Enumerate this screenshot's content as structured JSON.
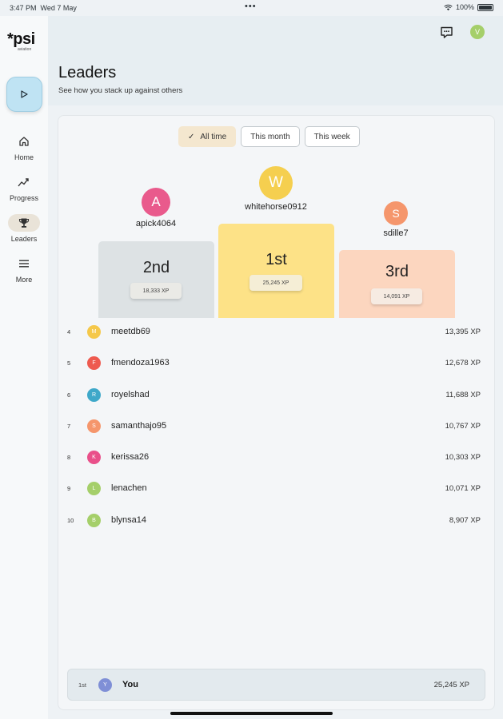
{
  "status_bar": {
    "time": "3:47 PM",
    "date": "Wed 7 May",
    "battery": "100%",
    "icons": [
      "wifi-icon",
      "battery-icon"
    ]
  },
  "app": {
    "logo_text": "*psi",
    "logo_sub": "aviation"
  },
  "sidebar": {
    "play_icon": "play-icon",
    "items": [
      {
        "label": "Home",
        "icon": "home-icon",
        "active": false
      },
      {
        "label": "Progress",
        "icon": "progress-chart-icon",
        "active": false
      },
      {
        "label": "Leaders",
        "icon": "trophy-icon",
        "active": true
      },
      {
        "label": "More",
        "icon": "menu-lines-icon",
        "active": false
      }
    ]
  },
  "header": {
    "title": "Leaders",
    "subtitle": "See how you stack up against others",
    "user_initial": "V",
    "chat_icon": "chat-icon"
  },
  "filters": [
    {
      "label": "All time",
      "selected": true
    },
    {
      "label": "This month",
      "selected": false
    },
    {
      "label": "This week",
      "selected": false
    }
  ],
  "podium": {
    "first": {
      "initial": "W",
      "name": "whitehorse0912",
      "place": "1st",
      "xp": "25,245 XP",
      "avatar_color": "#f5cf4f",
      "block_color": "#fde287"
    },
    "second": {
      "initial": "A",
      "name": "apick4064",
      "place": "2nd",
      "xp": "18,333 XP",
      "avatar_color": "#e95a8c",
      "block_color": "#dde2e4"
    },
    "third": {
      "initial": "S",
      "name": "sdille7",
      "place": "3rd",
      "xp": "14,091 XP",
      "avatar_color": "#f5966c",
      "block_color": "#fcd6bf"
    }
  },
  "leaderboard": [
    {
      "rank": "4",
      "initial": "M",
      "name": "meetdb69",
      "xp": "13,395 XP",
      "color": "#f5c84a"
    },
    {
      "rank": "5",
      "initial": "F",
      "name": "fmendoza1963",
      "xp": "12,678 XP",
      "color": "#ee5a4f"
    },
    {
      "rank": "6",
      "initial": "R",
      "name": "royelshad",
      "xp": "11,688 XP",
      "color": "#3ea8c9"
    },
    {
      "rank": "7",
      "initial": "S",
      "name": "samanthajo95",
      "xp": "10,767 XP",
      "color": "#f5966c"
    },
    {
      "rank": "8",
      "initial": "K",
      "name": "kerissa26",
      "xp": "10,303 XP",
      "color": "#e9508a"
    },
    {
      "rank": "9",
      "initial": "L",
      "name": "lenachen",
      "xp": "10,071 XP",
      "color": "#a5cf6a"
    },
    {
      "rank": "10",
      "initial": "B",
      "name": "blynsa14",
      "xp": "8,907 XP",
      "color": "#a5cf6a"
    }
  ],
  "you": {
    "rank": "1st",
    "initial": "Y",
    "name": "You",
    "xp": "25,245 XP"
  }
}
